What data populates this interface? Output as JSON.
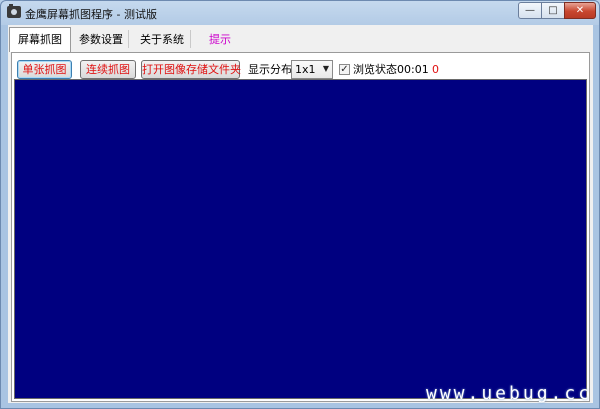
{
  "window": {
    "title": "金鹰屏幕抓图程序 - 测试版",
    "controls": {
      "minimize": "—",
      "maximize": "□",
      "close": "✕"
    }
  },
  "tabs": [
    {
      "label": "屏幕抓图",
      "active": true
    },
    {
      "label": "参数设置",
      "active": false
    },
    {
      "label": "关于系统",
      "active": false
    },
    {
      "label": "提示",
      "active": false
    }
  ],
  "toolbar": {
    "single_capture": "单张抓图",
    "continuous_capture": "连续抓图",
    "open_folder": "打开图像存储文件夹",
    "display_layout_label": "显示分布",
    "display_layout_value": "1x1",
    "browse_checked": true,
    "browse_label": "浏览状态",
    "timer": "00:01",
    "count": "0"
  },
  "colors": {
    "viewport_bg": "#000080",
    "button_text": "#e01010",
    "hint_tab": "#cc00cc",
    "count": "#e01010"
  },
  "watermark": "www.uebug.cc",
  "icons": [
    "app-camera-icon",
    "minimize-icon",
    "maximize-icon",
    "close-icon",
    "chevron-down-icon",
    "checkmark-icon"
  ]
}
